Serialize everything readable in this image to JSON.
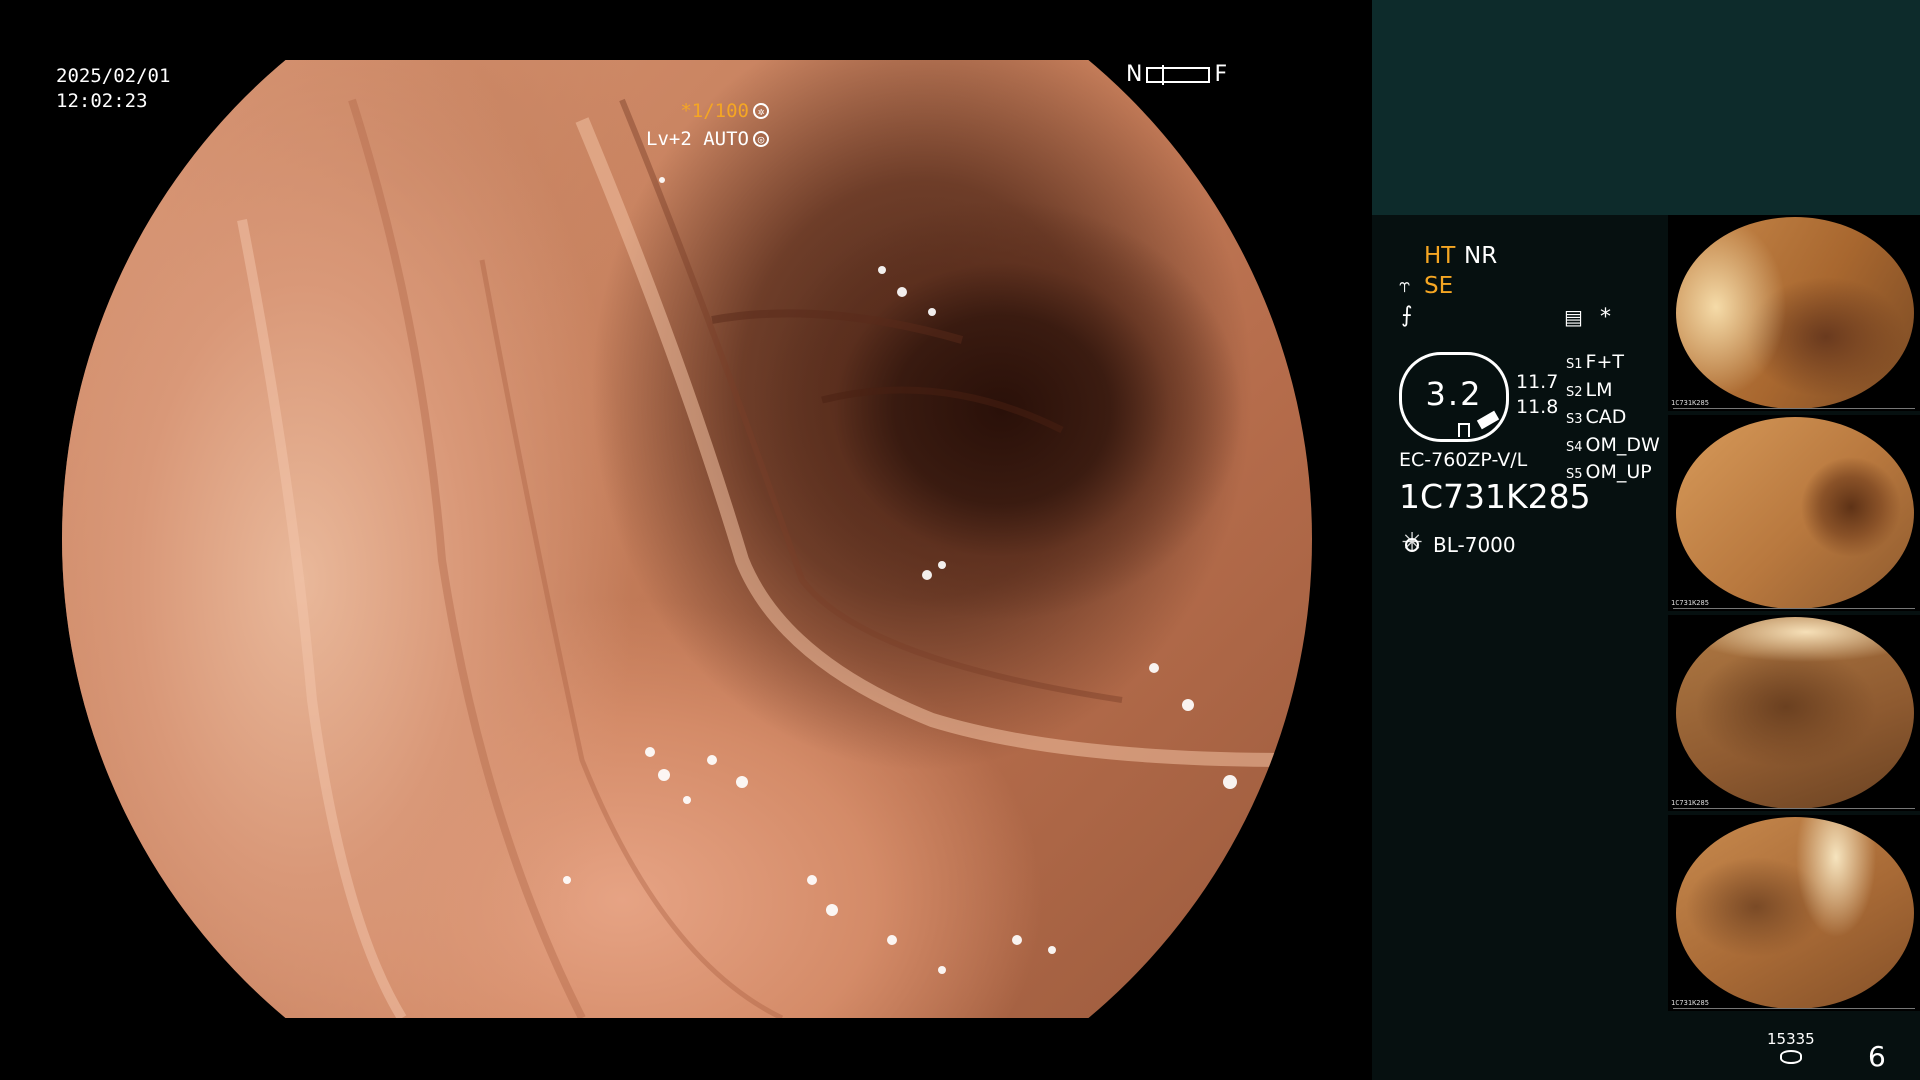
{
  "overlay": {
    "date": "2025/02/01",
    "time": "12:02:23",
    "focus_near": "N",
    "focus_far": "F",
    "shutter": "*1/100",
    "shutter_icon": "aperture-icon",
    "level": "Lv+2 AUTO",
    "level_icon": "iris-icon"
  },
  "panel": {
    "modes": {
      "ht": "HT",
      "nr": "NR",
      "se": "SE"
    },
    "mode_colors": {
      "active": "#f5a623",
      "inactive": "#ffffff"
    },
    "asterisk": "*",
    "dial_value": "3.2",
    "dial_readings": [
      "11.7",
      "11.8"
    ],
    "switches": [
      {
        "key": "S1",
        "value": "F+T"
      },
      {
        "key": "S2",
        "value": "LM"
      },
      {
        "key": "S3",
        "value": "CAD"
      },
      {
        "key": "S4",
        "value": "OM_DW"
      },
      {
        "key": "S5",
        "value": "OM_UP"
      }
    ],
    "scope_model": "EC-760ZP-V/L",
    "serial": "1C731K285",
    "light_source": "BL-7000",
    "image_count": "15335",
    "page": "6"
  },
  "thumbnails": [
    {
      "label": "1C731K285"
    },
    {
      "label": "1C731K285"
    },
    {
      "label": "1C731K285"
    },
    {
      "label": "1C731K285"
    }
  ]
}
